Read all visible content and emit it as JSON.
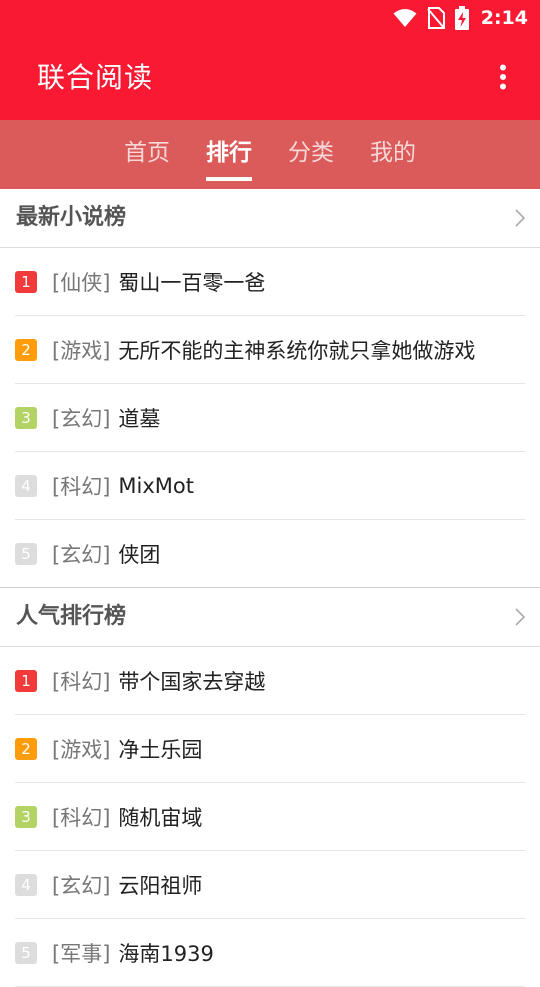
{
  "status_bar": {
    "time": "2:14",
    "icons": [
      "wifi-icon",
      "no-sim-icon",
      "battery-charging-icon"
    ]
  },
  "app_bar": {
    "title": "联合阅读",
    "menu_icon": "more-vert-icon"
  },
  "tabs": [
    {
      "label": "首页",
      "active": false
    },
    {
      "label": "排行",
      "active": true
    },
    {
      "label": "分类",
      "active": false
    },
    {
      "label": "我的",
      "active": false
    }
  ],
  "rank_colors": [
    "#f33a3a",
    "#ff9c0a",
    "#b3d465",
    "#dddddd",
    "#dddddd"
  ],
  "sections": [
    {
      "title": "最新小说榜",
      "items": [
        {
          "rank": "1",
          "category": "[仙侠]",
          "title": "蜀山一百零一爸"
        },
        {
          "rank": "2",
          "category": "[游戏]",
          "title": "无所不能的主神系统你就只拿她做游戏"
        },
        {
          "rank": "3",
          "category": "[玄幻]",
          "title": "道墓"
        },
        {
          "rank": "4",
          "category": "[科幻]",
          "title": "MixMot"
        },
        {
          "rank": "5",
          "category": "[玄幻]",
          "title": "侠团"
        }
      ]
    },
    {
      "title": "人气排行榜",
      "items": [
        {
          "rank": "1",
          "category": "[科幻]",
          "title": "带个国家去穿越"
        },
        {
          "rank": "2",
          "category": "[游戏]",
          "title": "净土乐园"
        },
        {
          "rank": "3",
          "category": "[科幻]",
          "title": "随机宙域"
        },
        {
          "rank": "4",
          "category": "[玄幻]",
          "title": "云阳祖师"
        },
        {
          "rank": "5",
          "category": "[军事]",
          "title": "海南1939"
        }
      ]
    }
  ]
}
